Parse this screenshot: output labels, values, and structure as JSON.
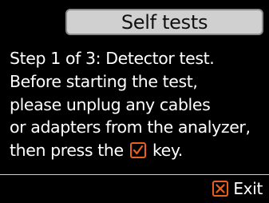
{
  "header": {
    "title": "Self tests"
  },
  "message": {
    "line1": "Step 1 of 3: Detector test.",
    "line2": "Before starting the test,",
    "line3": "please unplug any cables",
    "line4": "or adapters from the analyzer,",
    "line5_before_icon": "then press the",
    "line5_after_icon": "key.",
    "inline_icon": "check-key-icon"
  },
  "footer": {
    "exit_label": "Exit",
    "exit_icon": "cross-key-icon"
  },
  "colors": {
    "background": "#000000",
    "title_bar": "#d0d0d0",
    "text": "#ffffff",
    "accent": "#e8601c"
  }
}
